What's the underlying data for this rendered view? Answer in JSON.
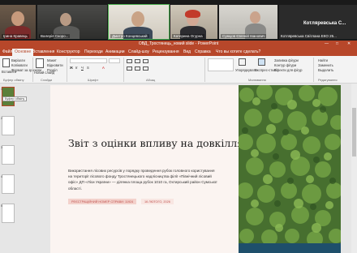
{
  "video": {
    "participants": [
      {
        "name": "Ірина Кравець"
      },
      {
        "name": "Валерія Скоро..."
      },
      {
        "name": "Дмитро Концевський"
      },
      {
        "name": "Катерина Огурна"
      },
      {
        "name": "Сумцов Євгеній Іванович"
      }
    ],
    "presenter_big": "Котляревська С...",
    "presenter_full": "Котляревська Світлана ЕКО 25..."
  },
  "titlebar": {
    "title": "ОВД_Тростянець_новий slide - PowerPoint",
    "minimize": "—",
    "maximize": "□",
    "close": "✕"
  },
  "menu": {
    "tabs": [
      "Файл",
      "Основне",
      "Вставлення",
      "Конструктор",
      "Переходи",
      "Анимации",
      "Слайд-шоу",
      "Рецензування",
      "Вид",
      "Справка",
      "Что вы хотите сделать?"
    ],
    "selected": "Основне"
  },
  "ribbon": {
    "paste": "Вставити",
    "cut": "Вирізати",
    "copy": "Копіювати",
    "format": "Формат за зразком",
    "new_slide": "Новий слайд",
    "layout": "Макет",
    "reset": "Відновити",
    "section": "Розділ",
    "arrange": "Упорядкувати",
    "quick_styles": "Експрес-стилі",
    "fill": "Заливка фігури",
    "outline": "Контур фігури",
    "effects": "Ефекти для фігур",
    "find": "Найти",
    "replace": "Заменить",
    "select": "Выделить",
    "group_clipboard": "Буфер обміну",
    "group_slides": "Слайди",
    "group_font": "Шрифт",
    "group_paragraph": "Абзац",
    "group_drawing": "Малювання",
    "group_editing": "Редагування"
  },
  "thumbs": {
    "tooltip": "Буфер обміну",
    "numbers": [
      "1",
      "2",
      "3",
      "4",
      "5"
    ]
  },
  "slide": {
    "heading": "Звіт з оцінки впливу на довкілля",
    "paragraph": "Використання лісових ресурсів у порядку проведення рубок головного користування на території лісового фонду Тростянецького надлісництва філії «Північний лісовий офіс» ДП «Ліси України» — ділянка площа рубок 1010 га, Охтирський район Сумської області.",
    "reg_number": "РЕЄСТРАЦІЙНИЙ НОМЕР СПРАВИ: 11924",
    "date": "16 ЛЮТОГО, 2026"
  },
  "colors": {
    "accent": "#b7472a",
    "slide_bg": "#fbf4f1",
    "forest": "#3d6b2a"
  }
}
